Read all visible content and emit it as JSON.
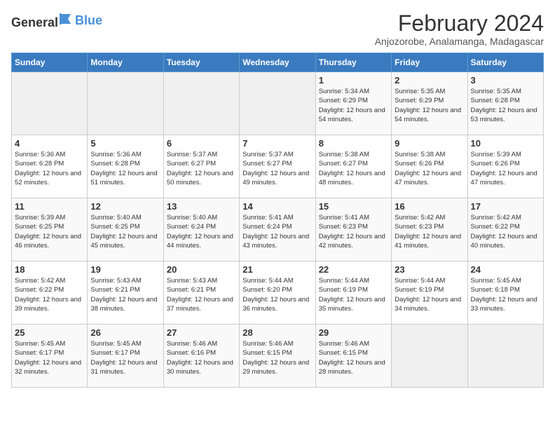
{
  "logo": {
    "general": "General",
    "blue": "Blue"
  },
  "title": "February 2024",
  "subtitle": "Anjozorobe, Analamanga, Madagascar",
  "days_of_week": [
    "Sunday",
    "Monday",
    "Tuesday",
    "Wednesday",
    "Thursday",
    "Friday",
    "Saturday"
  ],
  "weeks": [
    [
      {
        "day": "",
        "empty": true
      },
      {
        "day": "",
        "empty": true
      },
      {
        "day": "",
        "empty": true
      },
      {
        "day": "",
        "empty": true
      },
      {
        "day": "1",
        "sunrise": "5:34 AM",
        "sunset": "6:29 PM",
        "daylight": "12 hours and 54 minutes."
      },
      {
        "day": "2",
        "sunrise": "5:35 AM",
        "sunset": "6:29 PM",
        "daylight": "12 hours and 54 minutes."
      },
      {
        "day": "3",
        "sunrise": "5:35 AM",
        "sunset": "6:28 PM",
        "daylight": "12 hours and 53 minutes."
      }
    ],
    [
      {
        "day": "4",
        "sunrise": "5:36 AM",
        "sunset": "6:28 PM",
        "daylight": "12 hours and 52 minutes."
      },
      {
        "day": "5",
        "sunrise": "5:36 AM",
        "sunset": "6:28 PM",
        "daylight": "12 hours and 51 minutes."
      },
      {
        "day": "6",
        "sunrise": "5:37 AM",
        "sunset": "6:27 PM",
        "daylight": "12 hours and 50 minutes."
      },
      {
        "day": "7",
        "sunrise": "5:37 AM",
        "sunset": "6:27 PM",
        "daylight": "12 hours and 49 minutes."
      },
      {
        "day": "8",
        "sunrise": "5:38 AM",
        "sunset": "6:27 PM",
        "daylight": "12 hours and 48 minutes."
      },
      {
        "day": "9",
        "sunrise": "5:38 AM",
        "sunset": "6:26 PM",
        "daylight": "12 hours and 47 minutes."
      },
      {
        "day": "10",
        "sunrise": "5:39 AM",
        "sunset": "6:26 PM",
        "daylight": "12 hours and 47 minutes."
      }
    ],
    [
      {
        "day": "11",
        "sunrise": "5:39 AM",
        "sunset": "6:25 PM",
        "daylight": "12 hours and 46 minutes."
      },
      {
        "day": "12",
        "sunrise": "5:40 AM",
        "sunset": "6:25 PM",
        "daylight": "12 hours and 45 minutes."
      },
      {
        "day": "13",
        "sunrise": "5:40 AM",
        "sunset": "6:24 PM",
        "daylight": "12 hours and 44 minutes."
      },
      {
        "day": "14",
        "sunrise": "5:41 AM",
        "sunset": "6:24 PM",
        "daylight": "12 hours and 43 minutes."
      },
      {
        "day": "15",
        "sunrise": "5:41 AM",
        "sunset": "6:23 PM",
        "daylight": "12 hours and 42 minutes."
      },
      {
        "day": "16",
        "sunrise": "5:42 AM",
        "sunset": "6:23 PM",
        "daylight": "12 hours and 41 minutes."
      },
      {
        "day": "17",
        "sunrise": "5:42 AM",
        "sunset": "6:22 PM",
        "daylight": "12 hours and 40 minutes."
      }
    ],
    [
      {
        "day": "18",
        "sunrise": "5:42 AM",
        "sunset": "6:22 PM",
        "daylight": "12 hours and 39 minutes."
      },
      {
        "day": "19",
        "sunrise": "5:43 AM",
        "sunset": "6:21 PM",
        "daylight": "12 hours and 38 minutes."
      },
      {
        "day": "20",
        "sunrise": "5:43 AM",
        "sunset": "6:21 PM",
        "daylight": "12 hours and 37 minutes."
      },
      {
        "day": "21",
        "sunrise": "5:44 AM",
        "sunset": "6:20 PM",
        "daylight": "12 hours and 36 minutes."
      },
      {
        "day": "22",
        "sunrise": "5:44 AM",
        "sunset": "6:19 PM",
        "daylight": "12 hours and 35 minutes."
      },
      {
        "day": "23",
        "sunrise": "5:44 AM",
        "sunset": "6:19 PM",
        "daylight": "12 hours and 34 minutes."
      },
      {
        "day": "24",
        "sunrise": "5:45 AM",
        "sunset": "6:18 PM",
        "daylight": "12 hours and 33 minutes."
      }
    ],
    [
      {
        "day": "25",
        "sunrise": "5:45 AM",
        "sunset": "6:17 PM",
        "daylight": "12 hours and 32 minutes."
      },
      {
        "day": "26",
        "sunrise": "5:45 AM",
        "sunset": "6:17 PM",
        "daylight": "12 hours and 31 minutes."
      },
      {
        "day": "27",
        "sunrise": "5:46 AM",
        "sunset": "6:16 PM",
        "daylight": "12 hours and 30 minutes."
      },
      {
        "day": "28",
        "sunrise": "5:46 AM",
        "sunset": "6:15 PM",
        "daylight": "12 hours and 29 minutes."
      },
      {
        "day": "29",
        "sunrise": "5:46 AM",
        "sunset": "6:15 PM",
        "daylight": "12 hours and 28 minutes."
      },
      {
        "day": "",
        "empty": true
      },
      {
        "day": "",
        "empty": true
      }
    ]
  ],
  "labels": {
    "sunrise_prefix": "Sunrise: ",
    "sunset_prefix": "Sunset: ",
    "daylight_prefix": "Daylight: "
  }
}
